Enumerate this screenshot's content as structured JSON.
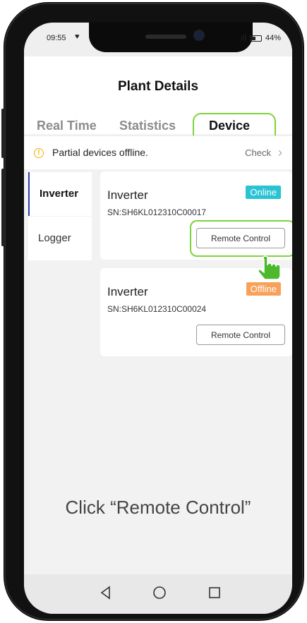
{
  "status": {
    "time": "09:55",
    "battery": "44%"
  },
  "header": {
    "title": "Plant Details",
    "tabs": [
      {
        "label": "Real Time"
      },
      {
        "label": "Statistics"
      },
      {
        "label": "Device"
      }
    ]
  },
  "alert": {
    "text": "Partial devices offline.",
    "action": "Check"
  },
  "sidebar": {
    "items": [
      {
        "label": "Inverter"
      },
      {
        "label": "Logger"
      }
    ]
  },
  "devices": [
    {
      "name": "Inverter",
      "sn": "SN:SH6KL012310C00017",
      "status": "Online",
      "status_color": "#29c3d3",
      "button": "Remote Control"
    },
    {
      "name": "Inverter",
      "sn": "SN:SH6KL012310C00024",
      "status": "Offline",
      "status_color": "#f8a15a",
      "button": "Remote Control"
    }
  ],
  "instruction": "Click “Remote Control”",
  "highlight_color": "#7cd43b"
}
